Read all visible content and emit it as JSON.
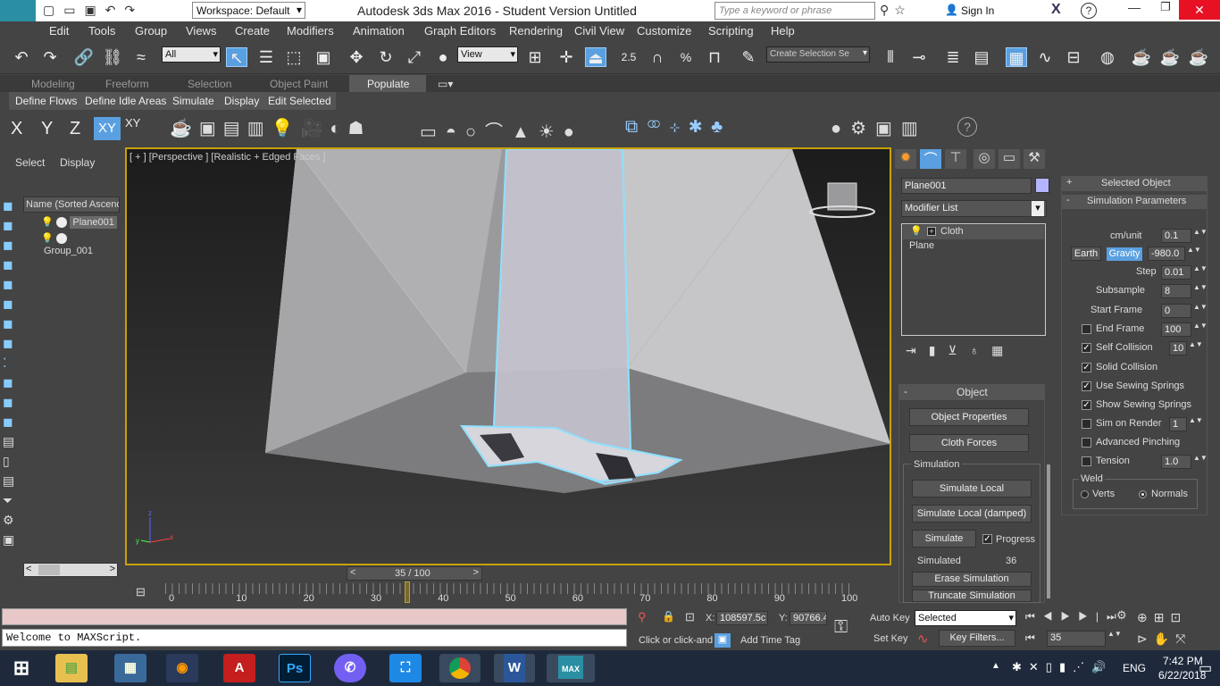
{
  "window": {
    "title": "Autodesk 3ds Max 2016 - Student Version    Untitled",
    "workspace": "Workspace: Default",
    "search_placeholder": "Type a keyword or phrase",
    "sign_in": "Sign In"
  },
  "menu": [
    "Edit",
    "Tools",
    "Group",
    "Views",
    "Create",
    "Modifiers",
    "Animation",
    "Graph Editors",
    "Rendering",
    "Civil View",
    "Customize",
    "Scripting",
    "Help"
  ],
  "toolbar": {
    "selection_filter": "All",
    "coord_system": "View",
    "snap_value": "2.5",
    "named_selection": "Create Selection Se"
  },
  "ribbon_tabs": [
    "Modeling",
    "Freeform",
    "Selection",
    "Object Paint",
    "Populate"
  ],
  "ribbon_active": "Populate",
  "ribbon_buttons": [
    "Define Flows",
    "Define Idle Areas",
    "Simulate",
    "Display",
    "Edit Selected"
  ],
  "axis_buttons": [
    "X",
    "Y",
    "Z",
    "XY",
    "XY"
  ],
  "scene_explorer": {
    "tabs": [
      "Select",
      "Display"
    ],
    "column_header": "Name (Sorted Ascend",
    "items": [
      "Plane001",
      "Group_001"
    ]
  },
  "viewport": {
    "label": "[ + ] [Perspective ] [Realistic + Edged Faces ]",
    "axis_x": "x",
    "axis_y": "y",
    "axis_z": "z"
  },
  "modify_panel": {
    "object_name": "Plane001",
    "modifier_list": "Modifier List",
    "stack": [
      "Cloth",
      "Plane"
    ],
    "object_rollout": "Object",
    "buttons": [
      "Object Properties",
      "Cloth Forces"
    ],
    "simulation_group": "Simulation",
    "sim_buttons": [
      "Simulate Local",
      "Simulate Local (damped)",
      "Simulate"
    ],
    "progress_label": "Progress",
    "progress_checked": true,
    "simulated_label": "Simulated",
    "simulated_value": "36",
    "erase_button": "Erase Simulation",
    "truncate_button": "Truncate Simulation"
  },
  "sim_params": {
    "selected_object": "Selected Object",
    "rollout": "Simulation Parameters",
    "cm_unit_label": "cm/unit",
    "cm_unit": "0.1",
    "earth": "Earth",
    "gravity_label": "Gravity",
    "gravity": "-980.0",
    "step_label": "Step",
    "step": "0.01",
    "subsample_label": "Subsample",
    "subsample": "8",
    "start_frame_label": "Start Frame",
    "start_frame": "0",
    "end_frame_label": "End Frame",
    "end_frame": "100",
    "end_frame_checked": false,
    "self_collision_label": "Self Collision",
    "self_collision": "10",
    "self_collision_checked": true,
    "solid_collision_label": "Solid Collision",
    "solid_collision_checked": true,
    "use_sewing_label": "Use Sewing Springs",
    "use_sewing_checked": true,
    "show_sewing_label": "Show Sewing Springs",
    "show_sewing_checked": true,
    "sim_on_render_label": "Sim on Render",
    "sim_on_render": "1",
    "sim_on_render_checked": false,
    "advanced_pinching_label": "Advanced Pinching",
    "advanced_pinching_checked": false,
    "tension_label": "Tension",
    "tension": "1.0",
    "tension_checked": false,
    "weld_label": "Weld",
    "verts": "Verts",
    "normals": "Normals"
  },
  "timeline": {
    "frame_display": "35 / 100",
    "current_frame": 35,
    "ticks": [
      "0",
      "10",
      "20",
      "30",
      "40",
      "50",
      "60",
      "70",
      "80",
      "90",
      "100"
    ]
  },
  "status": {
    "maxscript": "Welcome to MAXScript.",
    "prompt": "Click or click-and",
    "add_time_tag": "Add Time Tag",
    "x_label": "X:",
    "x_value": "108597.5c",
    "y_label": "Y:",
    "y_value": "90766.4",
    "auto_key": "Auto Key",
    "set_key": "Set Key",
    "key_mode": "Selected",
    "key_filters": "Key Filters...",
    "frame": "35"
  },
  "taskbar": {
    "lang": "ENG",
    "time": "7:42 PM",
    "date": "6/22/2018"
  },
  "colors": {
    "viewport_border": "#c8a200",
    "selection_highlight": "#5aa0e0",
    "cloth_outline": "#8ee0ff"
  }
}
